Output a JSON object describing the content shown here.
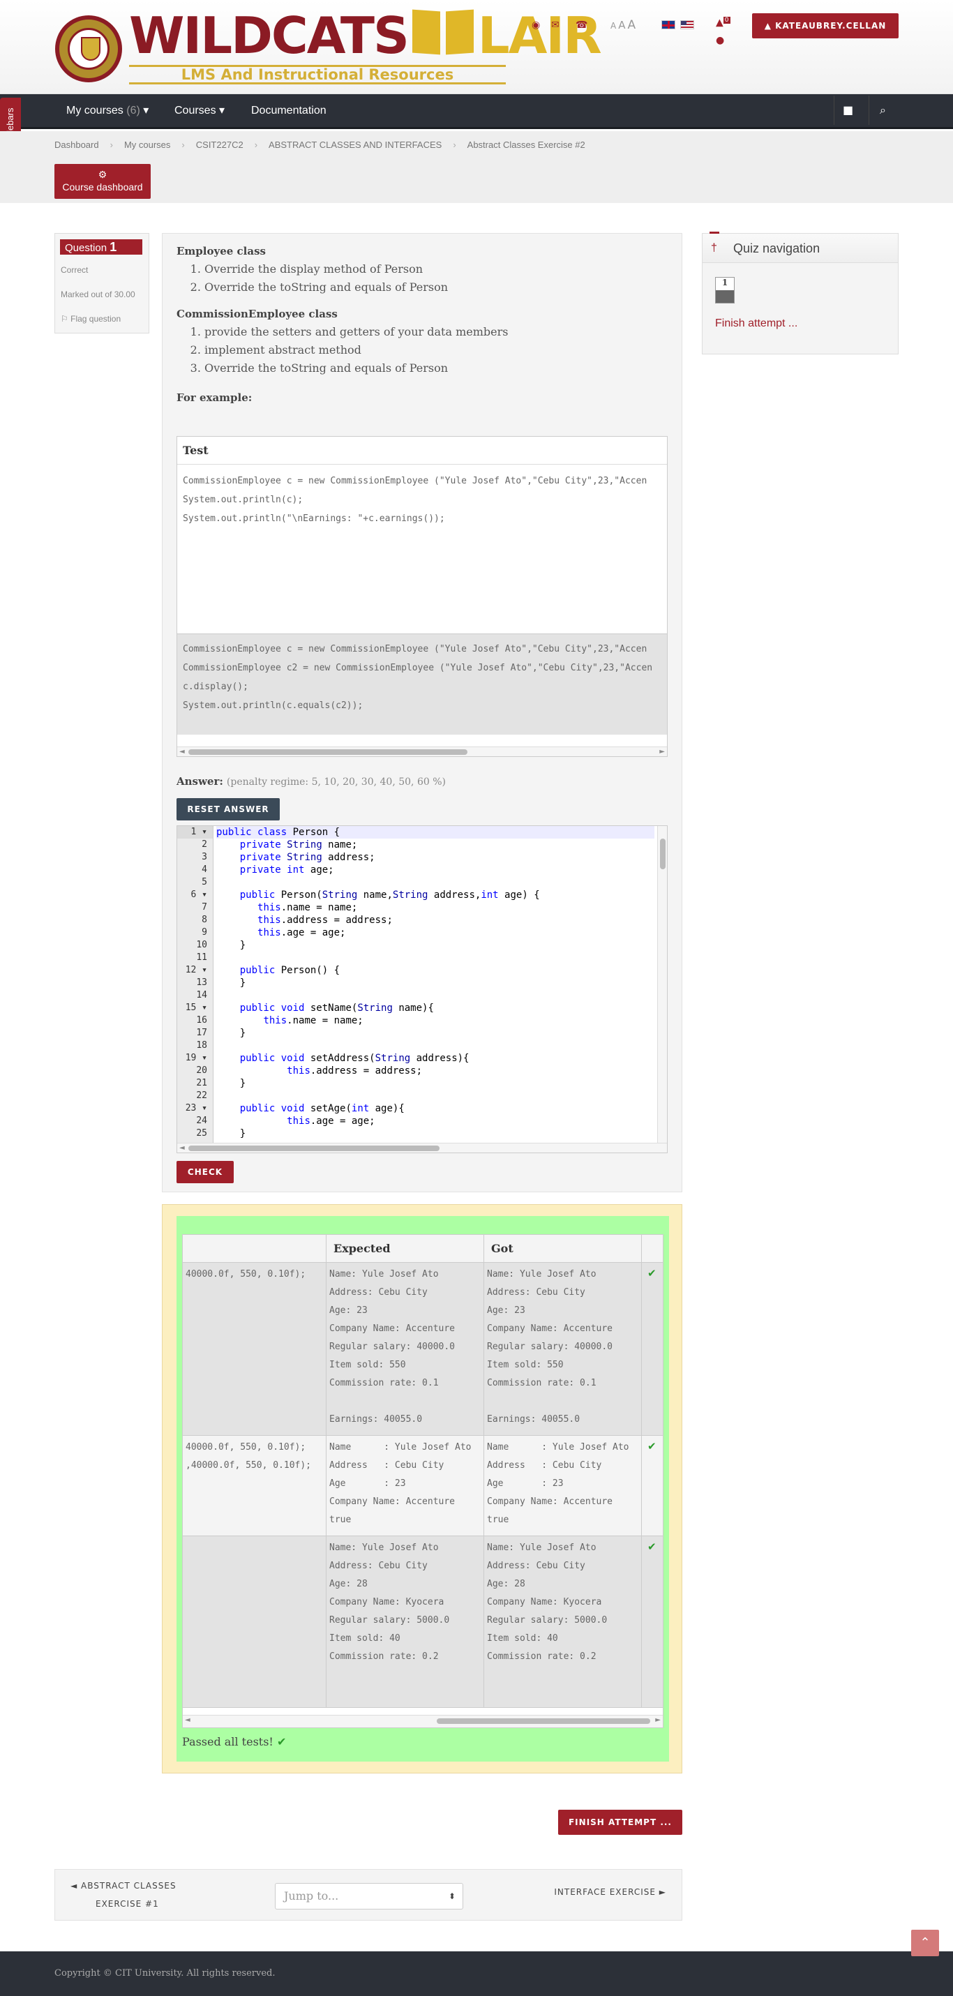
{
  "header": {
    "logo_alt": "WILDCATS LAIR",
    "logo_word1": "WILDCATS",
    "logo_word2": "LAIR",
    "logo_sub": "LMS And Instructional Resources",
    "font_sizes": [
      "A",
      "A",
      "A"
    ],
    "user_button": "KATEAUBREY.CELLAN",
    "notif_count": "0",
    "icons": [
      "map-marker-icon",
      "envelope-icon",
      "phone-icon",
      "comment-icon",
      "bell-icon"
    ]
  },
  "nav": {
    "my_courses": "My courses",
    "my_courses_count": "(6)",
    "courses": "Courses",
    "documentation": "Documentation"
  },
  "sidebar_toggle": "Hide sidebars",
  "breadcrumb": [
    "Dashboard",
    "My courses",
    "CSIT227C2",
    "ABSTRACT CLASSES AND INTERFACES",
    "Abstract Classes Exercise #2"
  ],
  "course_dashboard": "Course dashboard",
  "question_info": {
    "label": "Question",
    "number": "1",
    "state": "Correct",
    "grade": "Marked out of 30.00",
    "flag": "Flag question"
  },
  "question": {
    "h1": "Employee class",
    "list1": [
      "Override the display method of Person",
      "Override the toString and equals of Person"
    ],
    "h2": "CommissionEmployee class",
    "list2": [
      "provide the setters and getters of your data members",
      "implement abstract method",
      "Override the toString and equals of Person"
    ],
    "example": "For example:",
    "test_header": "Test",
    "test1": "CommissionEmployee c = new CommissionEmployee (\"Yule Josef Ato\",\"Cebu City\",23,\"Accen\nSystem.out.println(c);\nSystem.out.println(\"\\nEarnings: \"+c.earnings());",
    "test2": "CommissionEmployee c = new CommissionEmployee (\"Yule Josef Ato\",\"Cebu City\",23,\"Accen\nCommissionEmployee c2 = new CommissionEmployee (\"Yule Josef Ato\",\"Cebu City\",23,\"Accen\nc.display();\nSystem.out.println(c.equals(c2));",
    "answer_label": "Answer:",
    "penalty": "(penalty regime: 5, 10, 20, 30, 40, 50, 60 %)",
    "reset": "RESET ANSWER",
    "check": "CHECK"
  },
  "code_lines": [
    "public class Person {",
    "    private String name;",
    "    private String address;",
    "    private int age;",
    "",
    "    public Person(String name,String address,int age) {",
    "       this.name = name;",
    "       this.address = address;",
    "       this.age = age;",
    "    }",
    "",
    "    public Person() {",
    "    }",
    "",
    "    public void setName(String name){",
    "        this.name = name;",
    "    }",
    "",
    "    public void setAddress(String address){",
    "            this.address = address;",
    "    }",
    "",
    "    public void setAge(int age){",
    "            this.age = age;",
    "    }"
  ],
  "results": {
    "col_expected": "Expected",
    "col_got": "Got",
    "rows": [
      {
        "test": "40000.0f, 550, 0.10f);",
        "expected": "Name: Yule Josef Ato\nAddress: Cebu City\nAge: 23\nCompany Name: Accenture\nRegular salary: 40000.0\nItem sold: 550\nCommission rate: 0.1\n\nEarnings: 40055.0",
        "got": "Name: Yule Josef Ato\nAddress: Cebu City\nAge: 23\nCompany Name: Accenture\nRegular salary: 40000.0\nItem sold: 550\nCommission rate: 0.1\n\nEarnings: 40055.0"
      },
      {
        "test": "40000.0f, 550, 0.10f);\n,40000.0f, 550, 0.10f);",
        "expected": "Name      : Yule Josef Ato\nAddress   : Cebu City\nAge       : 23\nCompany Name: Accenture\ntrue",
        "got": "Name      : Yule Josef Ato\nAddress   : Cebu City\nAge       : 23\nCompany Name: Accenture\ntrue"
      },
      {
        "test": "",
        "expected": "Name: Yule Josef Ato\nAddress: Cebu City\nAge: 28\nCompany Name: Kyocera\nRegular salary: 5000.0\nItem sold: 40\nCommission rate: 0.2",
        "got": "Name: Yule Josef Ato\nAddress: Cebu City\nAge: 28\nCompany Name: Kyocera\nRegular salary: 5000.0\nItem sold: 40\nCommission rate: 0.2"
      }
    ],
    "passed": "Passed all tests!"
  },
  "quiz_nav": {
    "title": "Quiz navigation",
    "button": "1",
    "finish": "Finish attempt ..."
  },
  "finish_button": "FINISH ATTEMPT ...",
  "bottom_nav": {
    "prev_line1": "◄ ABSTRACT CLASSES",
    "prev_line2": "EXERCISE #1",
    "jump": "Jump to...",
    "next": "INTERFACE EXERCISE ►"
  },
  "footer": {
    "copyright": "Copyright © CIT University. All rights reserved."
  },
  "colors": {
    "brand": "#a0202a",
    "nav": "#2c3038",
    "gold": "#e0b728",
    "pass": "#acffa3"
  }
}
